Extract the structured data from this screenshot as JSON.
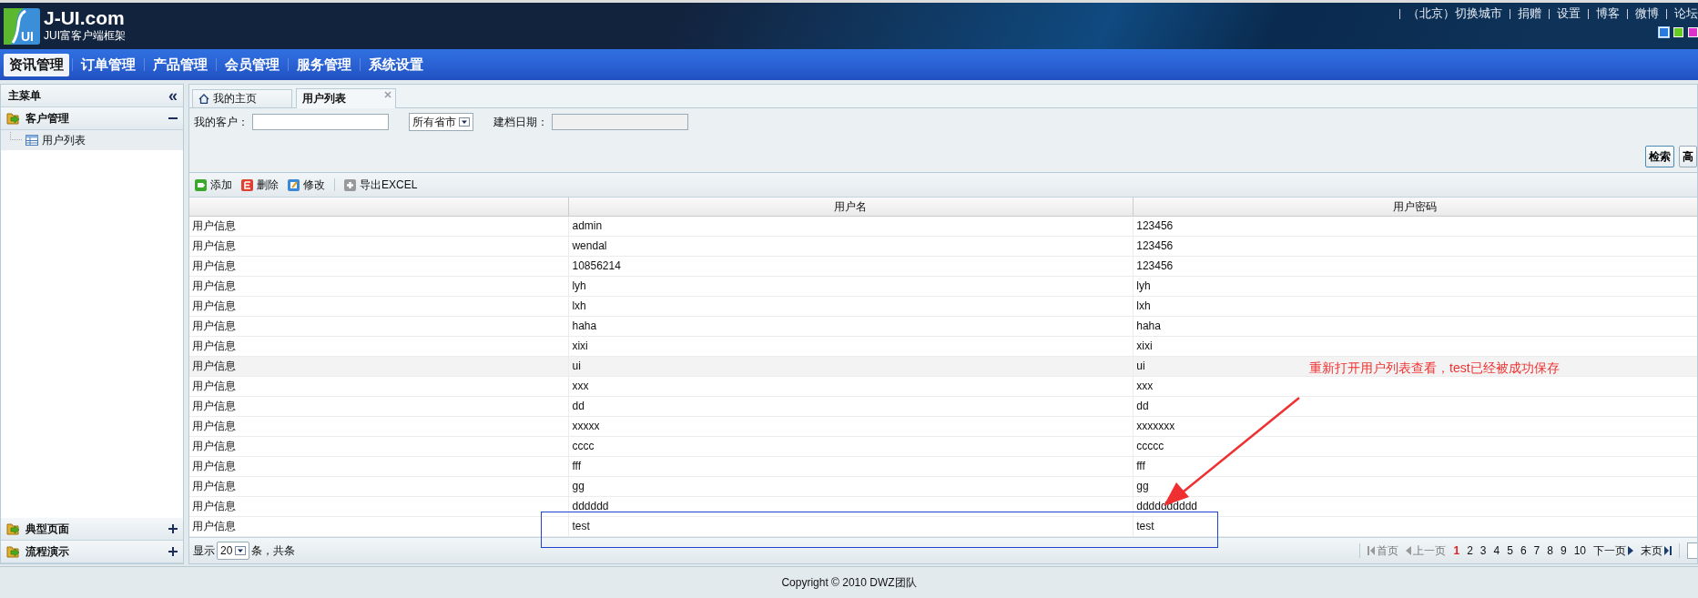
{
  "logo": {
    "mark": "UI",
    "title": "J-UI.com",
    "subtitle": "JUI富客户端框架"
  },
  "top_links": [
    "（北京）切换城市",
    "捐赠",
    "设置",
    "博客",
    "微博",
    "论坛"
  ],
  "themes": [
    {
      "color": "#2a7be0",
      "selected": true
    },
    {
      "color": "#66cc22",
      "selected": false
    },
    {
      "color": "#dd33cc",
      "selected": false
    }
  ],
  "nav": [
    {
      "label": "资讯管理",
      "selected": true
    },
    {
      "label": "订单管理",
      "selected": false
    },
    {
      "label": "产品管理",
      "selected": false
    },
    {
      "label": "会员管理",
      "selected": false
    },
    {
      "label": "服务管理",
      "selected": false
    },
    {
      "label": "系统设置",
      "selected": false
    }
  ],
  "sidebar": {
    "title": "主菜单",
    "collapse": "«",
    "groups": [
      {
        "label": "客户管理",
        "expanded": true,
        "children": [
          {
            "label": "用户列表",
            "selected": true
          }
        ]
      },
      {
        "label": "典型页面",
        "expanded": false
      },
      {
        "label": "流程演示",
        "expanded": false
      }
    ]
  },
  "tabs": [
    {
      "label": "我的主页",
      "kind": "home",
      "selected": false
    },
    {
      "label": "用户列表",
      "kind": "closable",
      "selected": true
    }
  ],
  "search": {
    "customer_label": "我的客户：",
    "province": "所有省市",
    "date_label": "建档日期：",
    "buttons": [
      "检索",
      "高"
    ]
  },
  "toolbar": [
    {
      "label": "添加",
      "kind": "add"
    },
    {
      "label": "删除",
      "kind": "delete"
    },
    {
      "label": "修改",
      "kind": "edit"
    },
    {
      "label": "导出EXCEL",
      "kind": "export"
    }
  ],
  "table": {
    "columns": [
      "用户名",
      "用户密码"
    ],
    "rows": [
      {
        "cells": [
          "用户信息",
          "admin",
          "123456"
        ],
        "selected": false
      },
      {
        "cells": [
          "用户信息",
          "wendal",
          "123456"
        ],
        "selected": false
      },
      {
        "cells": [
          "用户信息",
          "10856214",
          "123456"
        ],
        "selected": false
      },
      {
        "cells": [
          "用户信息",
          "lyh",
          "lyh"
        ],
        "selected": false
      },
      {
        "cells": [
          "用户信息",
          "lxh",
          "lxh"
        ],
        "selected": false
      },
      {
        "cells": [
          "用户信息",
          "haha",
          "haha"
        ],
        "selected": false
      },
      {
        "cells": [
          "用户信息",
          "xixi",
          "xixi"
        ],
        "selected": false
      },
      {
        "cells": [
          "用户信息",
          "ui",
          "ui"
        ],
        "selected": true
      },
      {
        "cells": [
          "用户信息",
          "xxx",
          "xxx"
        ],
        "selected": false
      },
      {
        "cells": [
          "用户信息",
          "dd",
          "dd"
        ],
        "selected": false
      },
      {
        "cells": [
          "用户信息",
          "xxxxx",
          "xxxxxxx"
        ],
        "selected": false
      },
      {
        "cells": [
          "用户信息",
          "cccc",
          "ccccc"
        ],
        "selected": false
      },
      {
        "cells": [
          "用户信息",
          "fff",
          "fff"
        ],
        "selected": false
      },
      {
        "cells": [
          "用户信息",
          "gg",
          "gg"
        ],
        "selected": false
      },
      {
        "cells": [
          "用户信息",
          "dddddd",
          "dddddddddd"
        ],
        "selected": false
      },
      {
        "cells": [
          "用户信息",
          "test",
          "test"
        ],
        "selected": false
      }
    ]
  },
  "pager": {
    "show": "显示",
    "size": "20",
    "summary": "条，共条",
    "first": "首页",
    "prev": "上一页",
    "pages": [
      {
        "label": "1",
        "selected": true
      },
      {
        "label": "2",
        "selected": false
      },
      {
        "label": "3",
        "selected": false
      },
      {
        "label": "4",
        "selected": false
      },
      {
        "label": "5",
        "selected": false
      },
      {
        "label": "6",
        "selected": false
      },
      {
        "label": "7",
        "selected": false
      },
      {
        "label": "8",
        "selected": false
      },
      {
        "label": "9",
        "selected": false
      },
      {
        "label": "10",
        "selected": false
      }
    ],
    "next": "下一页",
    "last": "末页"
  },
  "annotation": "重新打开用户列表查看，test已经被成功保存",
  "footer": "Copyright © 2010 DWZ团队"
}
